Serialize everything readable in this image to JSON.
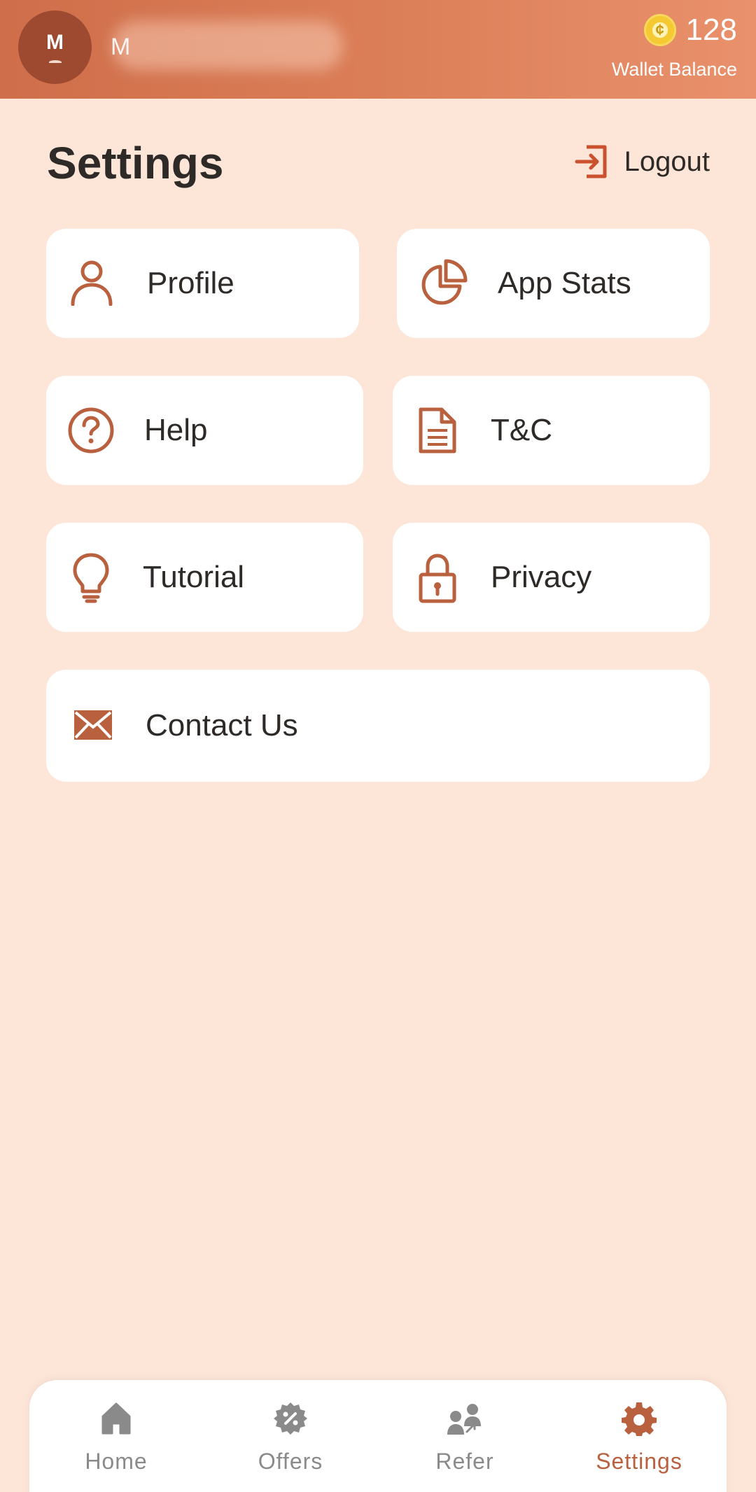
{
  "header": {
    "avatar_initial": "M",
    "username_initial": "M",
    "wallet_amount": "128",
    "wallet_label": "Wallet Balance",
    "coin_symbol": "¢"
  },
  "page": {
    "title": "Settings",
    "logout_label": "Logout"
  },
  "menu": {
    "profile": "Profile",
    "app_stats": "App Stats",
    "help": "Help",
    "tnc": "T&C",
    "tutorial": "Tutorial",
    "privacy": "Privacy",
    "contact": "Contact Us"
  },
  "nav": {
    "home": "Home",
    "offers": "Offers",
    "refer": "Refer",
    "settings": "Settings",
    "active": "settings"
  },
  "colors": {
    "accent": "#b9613f",
    "header_start": "#cf6e4a",
    "header_end": "#e9916c",
    "background": "#fde6d8",
    "card": "#ffffff"
  }
}
